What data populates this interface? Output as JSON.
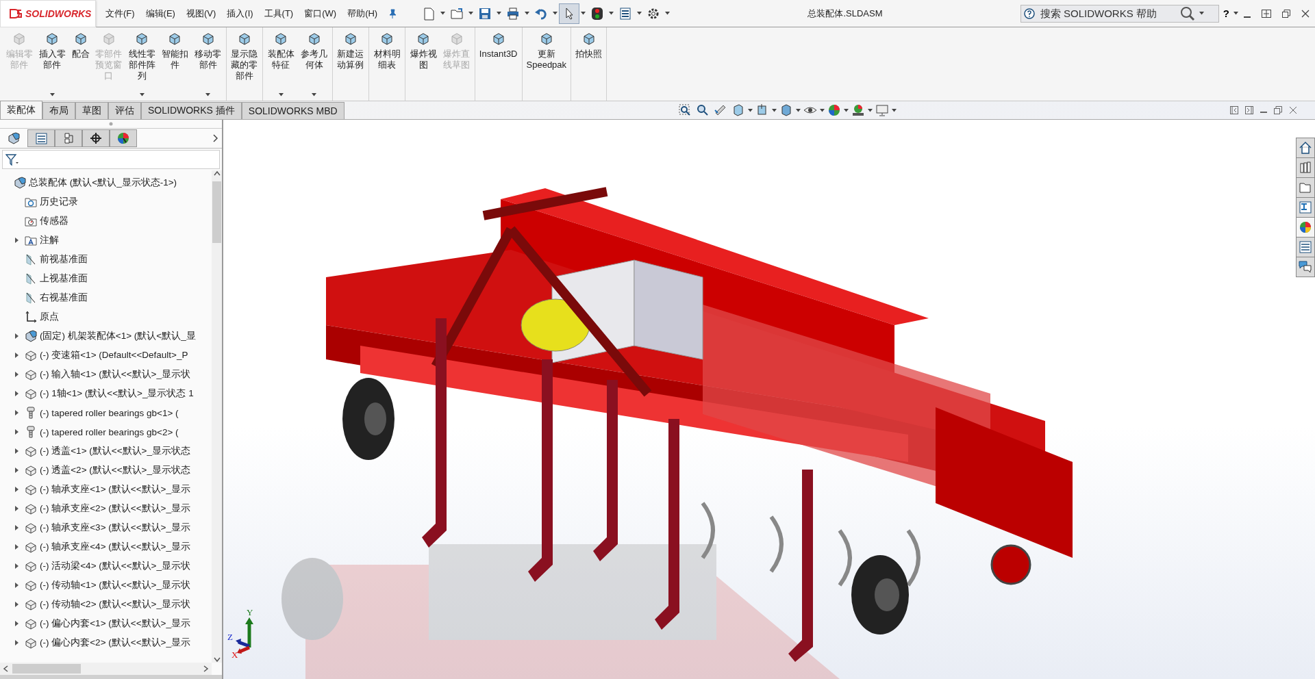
{
  "window": {
    "logo_text": "SOLIDWORKS",
    "title": "总装配体.SLDASM"
  },
  "menu": [
    "文件(F)",
    "编辑(E)",
    "视图(V)",
    "插入(I)",
    "工具(T)",
    "窗口(W)",
    "帮助(H)"
  ],
  "quick_tools": [
    {
      "kind": "new",
      "selected": false
    },
    {
      "kind": "open",
      "selected": false
    },
    {
      "kind": "save",
      "selected": false
    },
    {
      "kind": "print",
      "selected": false
    },
    {
      "kind": "undo",
      "selected": false
    },
    {
      "kind": "select",
      "selected": true
    },
    {
      "kind": "rebuild",
      "selected": false
    },
    {
      "kind": "file-properties",
      "selected": false
    },
    {
      "kind": "options",
      "selected": false
    }
  ],
  "search": {
    "placeholder": "搜索 SOLIDWORKS 帮助"
  },
  "help": "?",
  "ribbon": [
    {
      "buttons": [
        {
          "label": "编辑零部件",
          "disabled": true,
          "has_dropdown": false
        },
        {
          "label": "插入零部件",
          "disabled": false,
          "has_dropdown": true
        },
        {
          "label": "配合",
          "disabled": false,
          "has_dropdown": false
        },
        {
          "label": "零部件预览窗口",
          "disabled": true,
          "has_dropdown": false
        },
        {
          "label": "线性零部件阵列",
          "disabled": false,
          "has_dropdown": true
        },
        {
          "label": "智能扣件",
          "disabled": false,
          "has_dropdown": false
        },
        {
          "label": "移动零部件",
          "disabled": false,
          "has_dropdown": true
        }
      ]
    },
    {
      "buttons": [
        {
          "label": "显示隐藏的零部件",
          "disabled": false,
          "has_dropdown": false
        }
      ]
    },
    {
      "buttons": [
        {
          "label": "装配体特征",
          "disabled": false,
          "has_dropdown": true
        },
        {
          "label": "参考几何体",
          "disabled": false,
          "has_dropdown": true
        }
      ]
    },
    {
      "buttons": [
        {
          "label": "新建运动算例",
          "disabled": false,
          "has_dropdown": false
        }
      ]
    },
    {
      "buttons": [
        {
          "label": "材料明细表",
          "disabled": false,
          "has_dropdown": false
        }
      ]
    },
    {
      "buttons": [
        {
          "label": "爆炸视图",
          "disabled": false,
          "has_dropdown": false
        },
        {
          "label": "爆炸直线草图",
          "disabled": true,
          "has_dropdown": false
        }
      ]
    },
    {
      "buttons": [
        {
          "label": "Instant3D",
          "disabled": false,
          "has_dropdown": false
        }
      ]
    },
    {
      "buttons": [
        {
          "label": "更新 Speedpak",
          "disabled": false,
          "has_dropdown": false
        }
      ]
    },
    {
      "buttons": [
        {
          "label": "拍快照",
          "disabled": false,
          "has_dropdown": false
        }
      ]
    }
  ],
  "command_tabs": [
    {
      "label": "装配体",
      "selected": true
    },
    {
      "label": "布局",
      "selected": false
    },
    {
      "label": "草图",
      "selected": false
    },
    {
      "label": "评估",
      "selected": false
    },
    {
      "label": "SOLIDWORKS 插件",
      "selected": false
    },
    {
      "label": "SOLIDWORKS MBD",
      "selected": false
    }
  ],
  "panel_tabs": [
    {
      "kind": "feature-manager",
      "selected": true
    },
    {
      "kind": "property-manager",
      "selected": false
    },
    {
      "kind": "configuration-manager",
      "selected": false
    },
    {
      "kind": "dimxpert",
      "selected": false
    },
    {
      "kind": "display-manager",
      "selected": false
    }
  ],
  "tree": {
    "kind": "assembly",
    "label": "总装配体  (默认<默认_显示状态-1>)",
    "expandable": false,
    "children": [
      {
        "kind": "history",
        "label": "历史记录",
        "expandable": false
      },
      {
        "kind": "sensors",
        "label": "传感器",
        "expandable": false
      },
      {
        "kind": "annotations",
        "label": "注解",
        "expandable": true
      },
      {
        "kind": "plane",
        "label": "前视基准面",
        "expandable": false
      },
      {
        "kind": "plane",
        "label": "上视基准面",
        "expandable": false
      },
      {
        "kind": "plane",
        "label": "右视基准面",
        "expandable": false
      },
      {
        "kind": "origin",
        "label": "原点",
        "expandable": false
      },
      {
        "kind": "assembly",
        "label": "(固定) 机架装配体<1> (默认<默认_显",
        "expandable": true
      },
      {
        "kind": "part",
        "label": "(-) 变速箱<1> (Default<<Default>_P",
        "expandable": true
      },
      {
        "kind": "part",
        "label": "(-) 输入轴<1> (默认<<默认>_显示状",
        "expandable": true
      },
      {
        "kind": "part",
        "label": "(-) 1轴<1> (默认<<默认>_显示状态 1",
        "expandable": true
      },
      {
        "kind": "fastener",
        "label": "(-) tapered roller bearings gb<1> (",
        "expandable": true
      },
      {
        "kind": "fastener",
        "label": "(-) tapered roller bearings gb<2> (",
        "expandable": true
      },
      {
        "kind": "part",
        "label": "(-) 透盖<1> (默认<<默认>_显示状态",
        "expandable": true
      },
      {
        "kind": "part",
        "label": "(-) 透盖<2> (默认<<默认>_显示状态",
        "expandable": true
      },
      {
        "kind": "part",
        "label": "(-) 轴承支座<1> (默认<<默认>_显示",
        "expandable": true
      },
      {
        "kind": "part",
        "label": "(-) 轴承支座<2> (默认<<默认>_显示",
        "expandable": true
      },
      {
        "kind": "part",
        "label": "(-) 轴承支座<3> (默认<<默认>_显示",
        "expandable": true
      },
      {
        "kind": "part",
        "label": "(-) 轴承支座<4> (默认<<默认>_显示",
        "expandable": true
      },
      {
        "kind": "part",
        "label": "(-) 活动梁<4> (默认<<默认>_显示状",
        "expandable": true
      },
      {
        "kind": "part",
        "label": "(-) 传动轴<1> (默认<<默认>_显示状",
        "expandable": true
      },
      {
        "kind": "part",
        "label": "(-) 传动轴<2> (默认<<默认>_显示状",
        "expandable": true
      },
      {
        "kind": "part",
        "label": "(-) 偏心内套<1> (默认<<默认>_显示",
        "expandable": true
      },
      {
        "kind": "part",
        "label": "(-) 偏心内套<2> (默认<<默认>_显示",
        "expandable": true
      }
    ]
  },
  "task_pane_tabs": [
    {
      "kind": "resources",
      "selected": false
    },
    {
      "kind": "design-library",
      "selected": false
    },
    {
      "kind": "file-explorer",
      "selected": false
    },
    {
      "kind": "view-palette",
      "selected": false
    },
    {
      "kind": "appearances",
      "selected": true
    },
    {
      "kind": "custom-properties",
      "selected": false
    },
    {
      "kind": "forum",
      "selected": false
    }
  ],
  "triad": {
    "x": "X",
    "y": "Y",
    "z": "Z"
  }
}
